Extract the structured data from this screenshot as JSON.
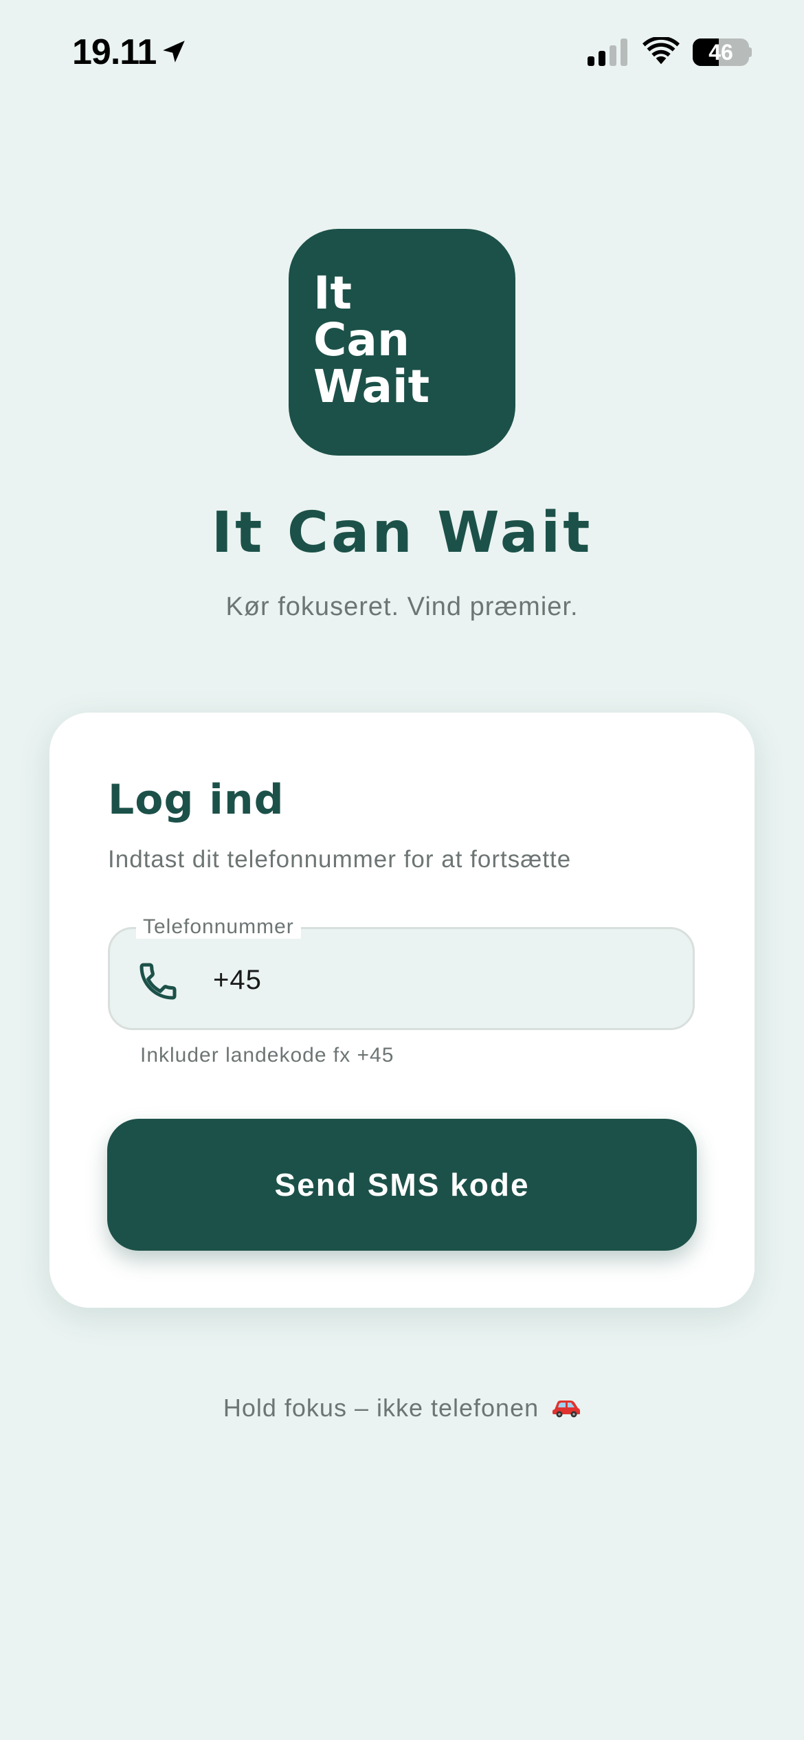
{
  "status_bar": {
    "time": "19.11",
    "battery_text": "46",
    "battery_level": 0.46,
    "icons": [
      "location-arrow-icon",
      "cellular-signal-icon",
      "wifi-icon",
      "battery-icon"
    ]
  },
  "logo": {
    "lines": [
      "It",
      "Can",
      "Wait"
    ]
  },
  "header": {
    "app_title": "It Can Wait",
    "tagline": "Kør fokuseret. Vind præmier."
  },
  "login_card": {
    "title": "Log ind",
    "subtitle": "Indtast dit telefonnummer for at fortsætte",
    "phone_field": {
      "label": "Telefonnummer",
      "value": "+45",
      "helper": "Inkluder landekode fx +45",
      "icon": "phone-icon"
    },
    "submit_label": "Send SMS kode"
  },
  "footer": {
    "text": "Hold fokus – ikke telefonen",
    "icon": "car-icon"
  },
  "colors": {
    "background": "#eaf3f1",
    "brand": "#1c5149",
    "card": "#ffffff",
    "muted_text": "#6d7574"
  }
}
